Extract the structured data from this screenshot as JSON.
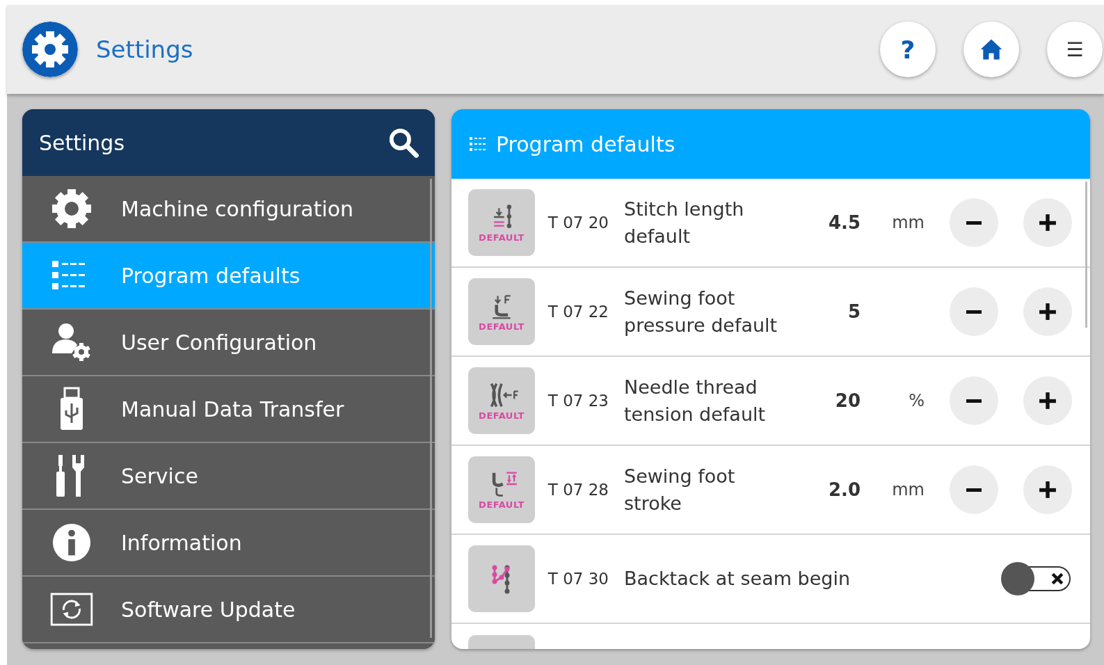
{
  "app_bar": {
    "title": "Settings",
    "buttons": [
      {
        "kind": "help",
        "label": "?"
      },
      {
        "kind": "home"
      },
      {
        "kind": "menu",
        "label": "☰"
      }
    ]
  },
  "sidebar": {
    "title": "Settings",
    "items": [
      {
        "label": "Machine configuration",
        "selected": false
      },
      {
        "label": "Program defaults",
        "selected": true
      },
      {
        "label": "User Configuration",
        "selected": false
      },
      {
        "label": "Manual Data Transfer",
        "selected": false
      },
      {
        "label": "Service",
        "selected": false
      },
      {
        "label": "Information",
        "selected": false
      },
      {
        "label": "Software Update",
        "selected": false
      }
    ]
  },
  "panel": {
    "title": "Program defaults",
    "rows": [
      {
        "kind": "stepper",
        "badge": "DEFAULT",
        "code": "T 07 20",
        "label": "Stitch length default",
        "value": "4.5",
        "unit": "mm"
      },
      {
        "kind": "stepper",
        "badge": "DEFAULT",
        "code": "T 07 22",
        "label": "Sewing foot pressure default",
        "value": "5"
      },
      {
        "kind": "stepper",
        "badge": "DEFAULT",
        "code": "T 07 23",
        "label": "Needle thread tension default",
        "value": "20",
        "unit": "%"
      },
      {
        "kind": "stepper",
        "badge": "DEFAULT",
        "code": "T 07 28",
        "label": "Sewing foot stroke",
        "value": "2.0",
        "unit": "mm"
      },
      {
        "kind": "toggle",
        "code": "T 07 30",
        "label": "Backtack at seam begin",
        "on": false
      }
    ]
  }
}
